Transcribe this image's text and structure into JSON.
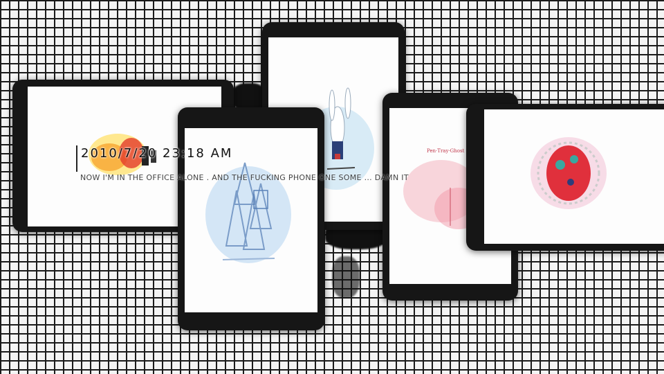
{
  "overlay": {
    "timestamp": "2010/7/20 23:18 AM",
    "caption": "NOW I'M IN THE OFFICE ALONE . AND THE FUCKING PHONE ONE SOME  ... DAMN IT"
  },
  "cards": [
    {
      "name": "fire-character-card",
      "art": "fire-character-illustration"
    },
    {
      "name": "rabbit-card",
      "art": "white-rabbit-illustration"
    },
    {
      "name": "card-tower-card",
      "art": "house-of-cards-illustration"
    },
    {
      "name": "pink-text-card",
      "art": "pink-watercolor-illustration",
      "title": "Pen·Tray·Ghost"
    },
    {
      "name": "red-ornament-card",
      "art": "red-ornament-illustration"
    }
  ],
  "colors": {
    "frame": "#161616",
    "grid_line": "#1a1a1a",
    "background": "#f4f4f4",
    "accent_red": "#e0303c",
    "accent_blue": "#8fb3e0"
  }
}
